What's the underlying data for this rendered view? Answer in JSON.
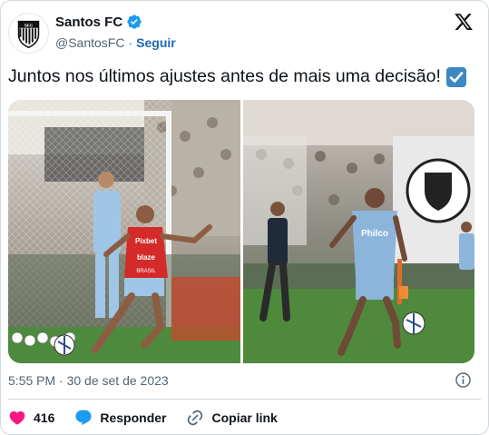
{
  "account": {
    "name": "Santos FC",
    "handle": "@SantosFC",
    "separator": "·",
    "follow_label": "Seguir"
  },
  "tweet": {
    "text": "Juntos nos últimos ajustes antes de mais uma decisão!"
  },
  "media": {
    "left_photo": {
      "shirt_text_1": "Pixbet",
      "shirt_text_2": "blaze",
      "shirt_text_3": "BRASIL"
    },
    "right_photo": {
      "shirt_text": "Philco"
    }
  },
  "meta": {
    "timestamp": "5:55 PM · 30 de set de 2023"
  },
  "actions": {
    "likes_count": "416",
    "reply_label": "Responder",
    "copy_link_label": "Copiar link"
  },
  "colors": {
    "verified_blue": "#1d9bf0",
    "follow_blue": "#1d68b8",
    "like_pink": "#f91880",
    "reply_blue": "#1d9bf0",
    "checkbox_blue": "#3b88c3"
  },
  "icons": {
    "verified": "verified-badge-icon",
    "brand": "x-logo-icon",
    "info": "info-icon",
    "like": "heart-icon",
    "reply": "speech-bubble-icon",
    "link": "link-icon",
    "emoji": "check-box-emoji"
  }
}
